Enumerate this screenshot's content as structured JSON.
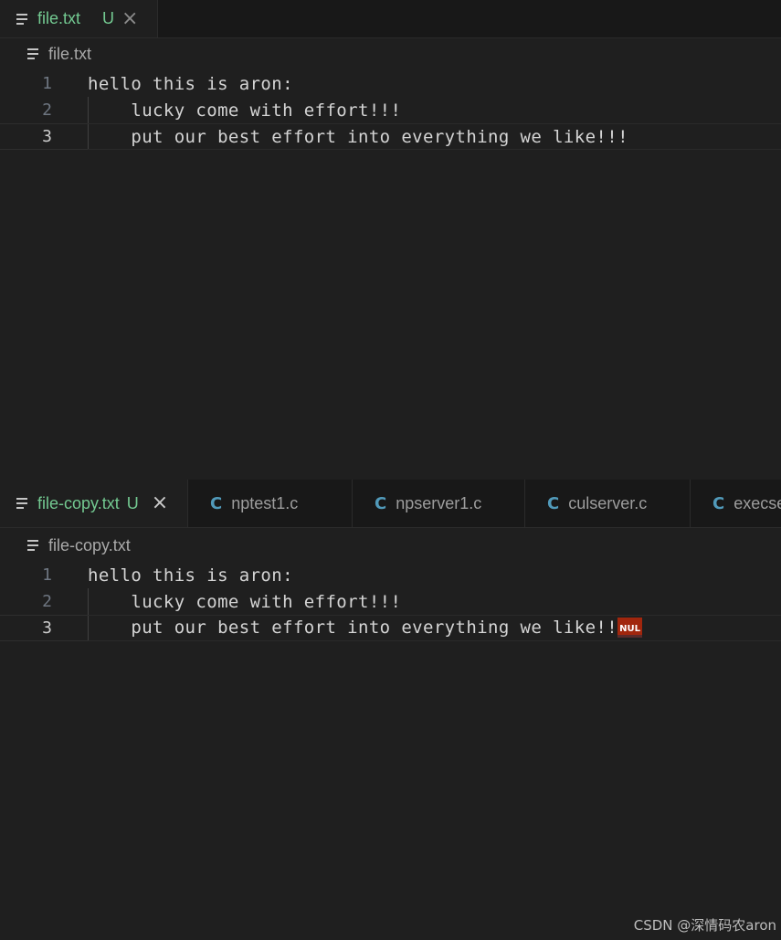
{
  "top_editor": {
    "tab": {
      "label": "file.txt",
      "status": "U",
      "close_glyph": "×"
    },
    "breadcrumb": "file.txt",
    "lines": [
      {
        "number": "1",
        "text": "hello this is aron:"
      },
      {
        "number": "2",
        "text": "    lucky come with effort!!!"
      },
      {
        "number": "3",
        "text": "    put our best effort into everything we like!!!"
      }
    ]
  },
  "bottom_editor": {
    "tabs": [
      {
        "label": "file-copy.txt",
        "status": "U",
        "close_glyph": "×"
      },
      {
        "label": "nptest1.c",
        "icon": "C"
      },
      {
        "label": "npserver1.c",
        "icon": "C"
      },
      {
        "label": "culserver.c",
        "icon": "C"
      },
      {
        "label": "execse",
        "icon": "C"
      }
    ],
    "breadcrumb": "file-copy.txt",
    "lines": [
      {
        "number": "1",
        "text": "hello this is aron:"
      },
      {
        "number": "2",
        "text": "    lucky come with effort!!!"
      },
      {
        "number": "3",
        "text": "    put our best effort into everything we like!!"
      }
    ],
    "control_char": "NUL"
  },
  "watermark": "CSDN @深情码农aron",
  "colors": {
    "background": "#1f1f1f",
    "tab_inactive": "#181818",
    "untracked_green": "#73c991",
    "c_icon_blue": "#519aba",
    "focus_accent": "#0078d4",
    "control_char_red": "#a1260d"
  }
}
